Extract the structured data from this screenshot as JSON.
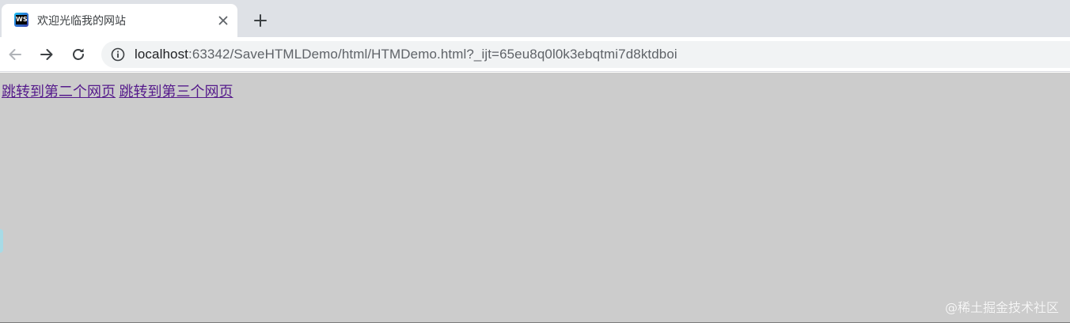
{
  "tab": {
    "title": "欢迎光临我的网站",
    "favicon_text": "WS",
    "favicon_icon": "webstorm-icon",
    "close_icon": "close-icon",
    "new_tab_icon": "plus-icon"
  },
  "toolbar": {
    "back_icon": "arrow-left-icon",
    "forward_icon": "arrow-right-icon",
    "reload_icon": "reload-icon",
    "site_info_icon": "info-icon",
    "url_host": "localhost",
    "url_rest": ":63342/SaveHTMLDemo/html/HTMDemo.html?_ijt=65eu8q0l0k3ebqtmi7d8ktdboi"
  },
  "page": {
    "background": "#cccccc",
    "link_color": "#551a8b",
    "links": [
      {
        "label": "跳转到第二个网页"
      },
      {
        "label": "跳转到第三个网页"
      }
    ]
  },
  "watermark": "@稀土掘金技术社区"
}
